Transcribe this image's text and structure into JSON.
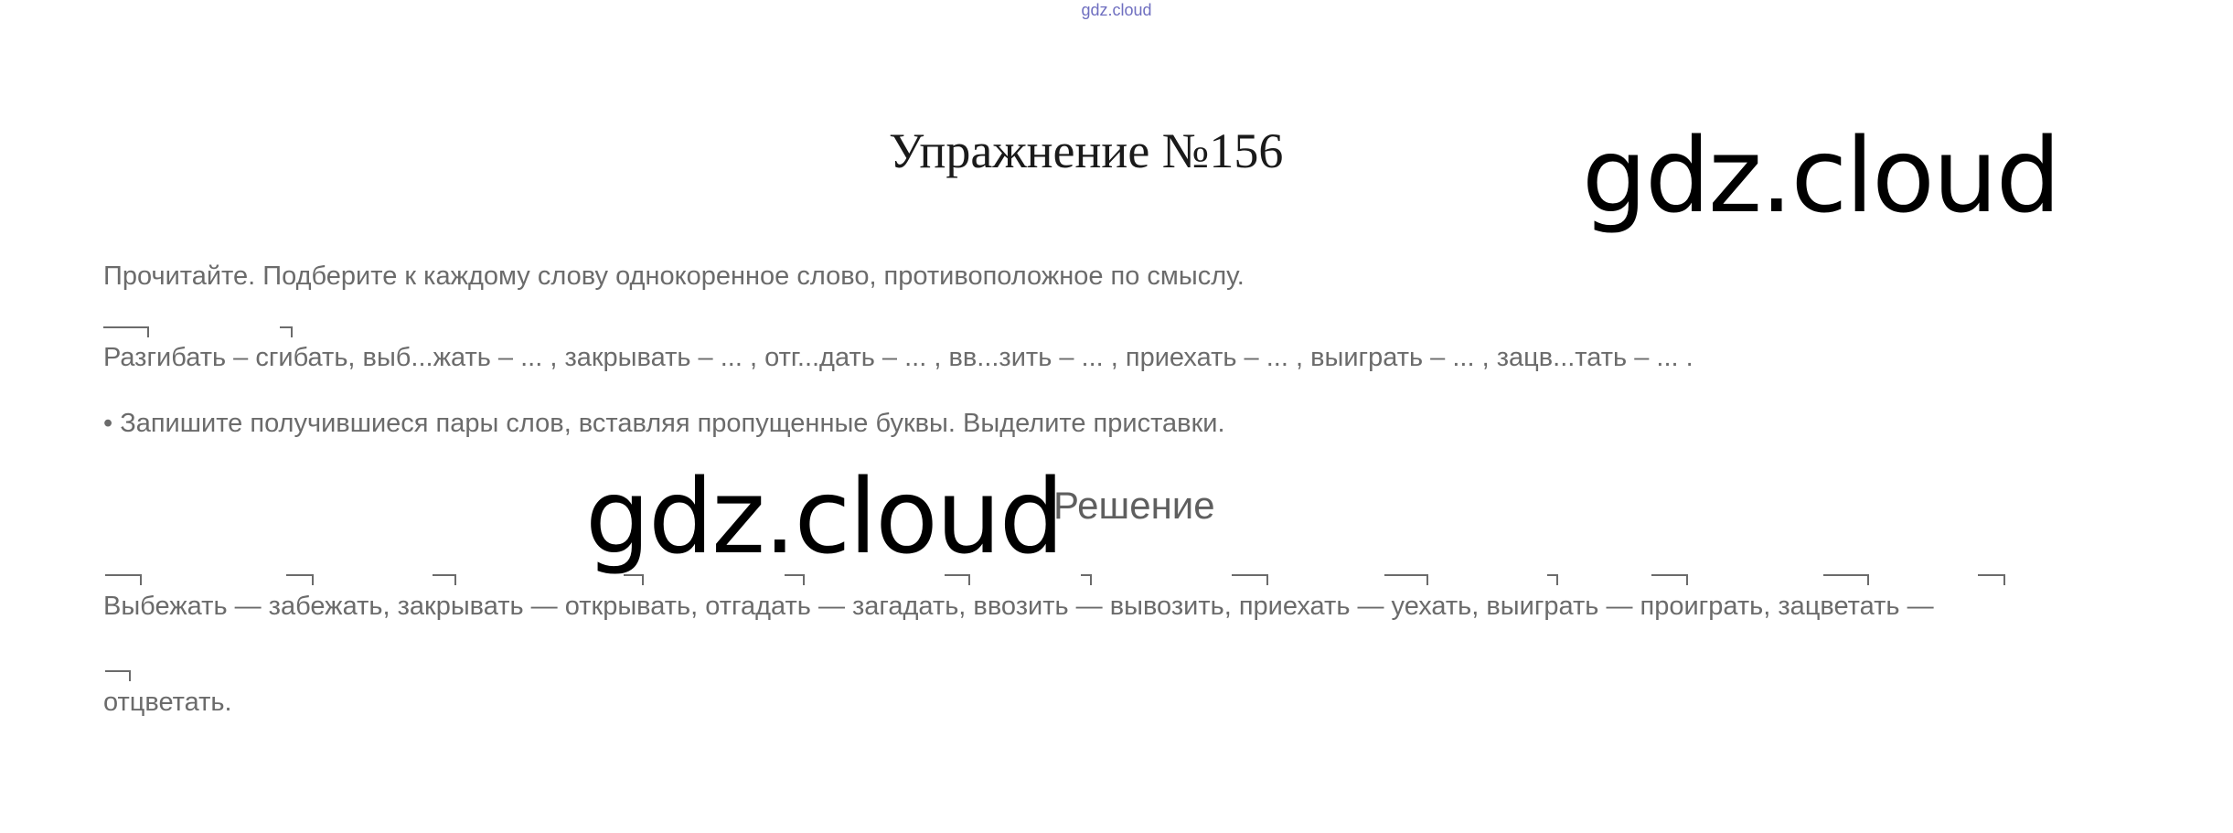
{
  "header": {
    "small_watermark": "gdz.cloud"
  },
  "exercise": {
    "title": "Упражнение №156",
    "instruction": "Прочитайте. Подберите к каждому слову однокоренное слово, противоположное по смыслу.",
    "words": "Разгибать – сгибать, выб...жать – ... , закрывать – ... , отг...дать – ... , вв...зить – ... , приехать – ... , выиграть – ... , зацв...тать – ... .",
    "task": "• Запишите получившиеся пары слов, вставляя пропущенные буквы. Выделите приставки."
  },
  "solution": {
    "heading": "Решение",
    "answer_line_1": "Выбежать — забежать, закрывать — открывать, отгадать — загадать, ввозить — вывозить, приехать — уехать, выиграть — проиграть, зацветать —",
    "answer_line_2": "отцветать."
  },
  "watermarks": {
    "top_right": "gdz.cloud",
    "middle": "gdz.cloud"
  }
}
